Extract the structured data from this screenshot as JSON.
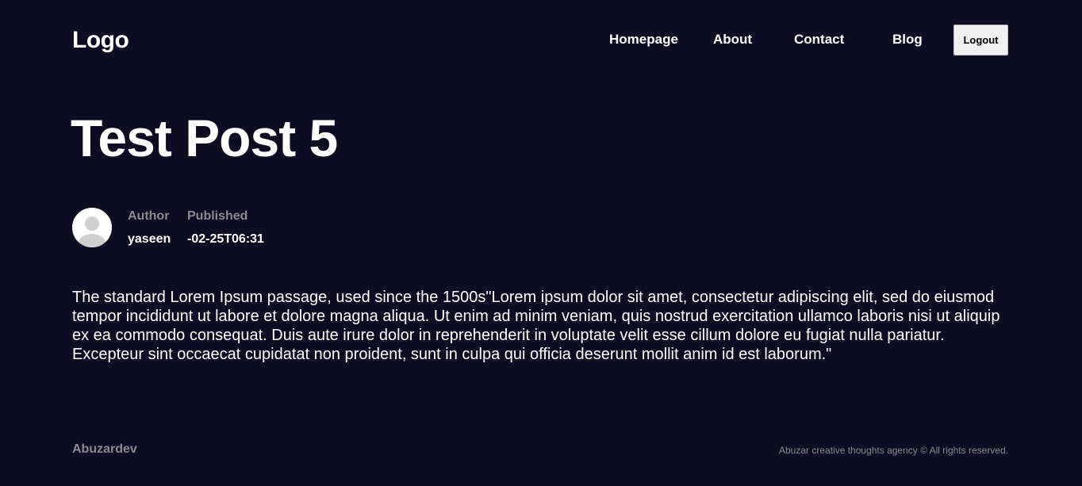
{
  "header": {
    "logo": "Logo",
    "nav": {
      "homepage": "Homepage",
      "about": "About",
      "contact": "Contact",
      "blog": "Blog"
    },
    "logout_label": "Logout"
  },
  "post": {
    "title": "Test Post 5",
    "author_label": "Author",
    "author_value": "yaseen",
    "published_label": "Published",
    "published_value": "-02-25T06:31",
    "body": "The standard Lorem Ipsum passage, used since the 1500s\"Lorem ipsum dolor sit amet, consectetur adipiscing elit, sed do eiusmod tempor incididunt ut labore et dolore magna aliqua. Ut enim ad minim veniam, quis nostrud exercitation ullamco laboris nisi ut aliquip ex ea commodo consequat. Duis aute irure dolor in reprehenderit in voluptate velit esse cillum dolore eu fugiat nulla pariatur. Excepteur sint occaecat cupidatat non proident, sunt in culpa qui officia deserunt mollit anim id est laborum.\""
  },
  "footer": {
    "brand": "Abuzardev",
    "copyright": "Abuzar creative thoughts agency © All rights reserved."
  },
  "colors": {
    "background": "#0d0c22",
    "muted_text": "#8a8a8f",
    "button_bg": "#efefef"
  },
  "icons": {
    "avatar": "user-avatar-icon"
  }
}
